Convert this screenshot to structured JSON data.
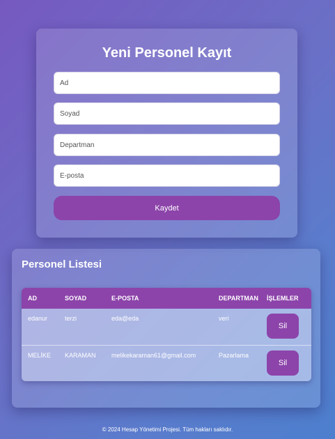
{
  "form": {
    "title": "Yeni Personel Kayıt",
    "fields": [
      {
        "placeholder": "Ad",
        "value": ""
      },
      {
        "placeholder": "Soyad",
        "value": ""
      },
      {
        "placeholder": "Departman",
        "value": ""
      },
      {
        "placeholder": "E-posta",
        "value": ""
      }
    ],
    "submit_label": "Kaydet"
  },
  "list": {
    "title": "Personel Listesi",
    "columns": [
      "AD",
      "SOYAD",
      "E-POSTA",
      "DEPARTMAN",
      "İŞLEMLER"
    ],
    "rows": [
      {
        "ad": "edanur",
        "soyad": "terzi",
        "eposta": "eda@eda",
        "departman": "veri",
        "action": "Sil"
      },
      {
        "ad": "MELİKE",
        "soyad": "KARAMAN",
        "eposta": "melikekaraman61@gmail.com",
        "departman": "Pazarlama",
        "action": "Sil"
      }
    ]
  },
  "footer": "© 2024 Hesap Yönetimi Projesi. Tüm hakları saklıdır.",
  "colors": {
    "accent": "#8c44aa",
    "background_start": "#7659c0",
    "background_end": "#4d7fce"
  }
}
